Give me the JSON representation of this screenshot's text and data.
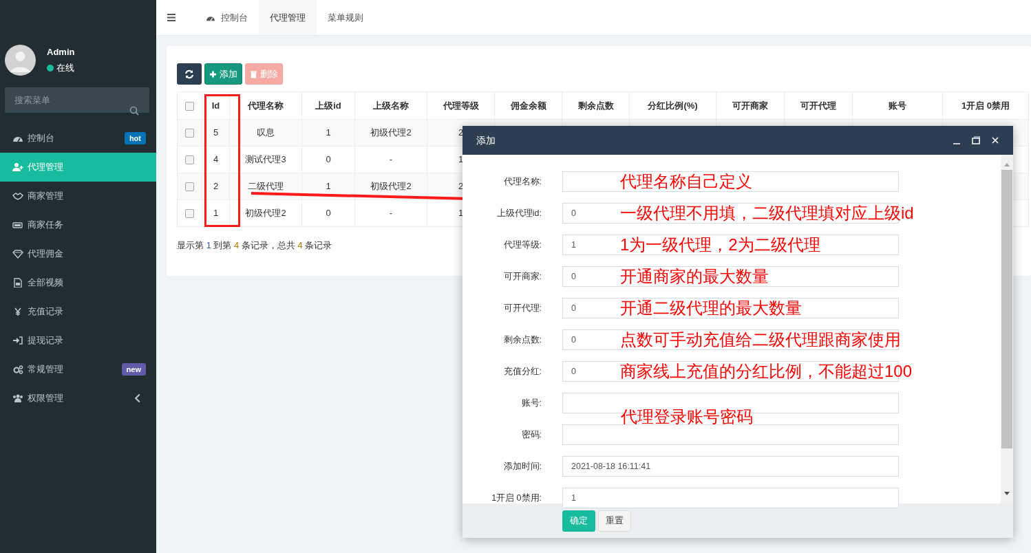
{
  "sidebar": {
    "user": {
      "name": "Admin",
      "status": "在线"
    },
    "search": {
      "placeholder": "搜索菜单"
    },
    "items": [
      {
        "label": "控制台",
        "selected": false,
        "has_submenu": false,
        "badge": {
          "text": "hot",
          "color": "#0073b7"
        }
      },
      {
        "label": "代理管理",
        "selected": true,
        "has_submenu": false
      },
      {
        "label": "商家管理",
        "selected": false,
        "has_submenu": false
      },
      {
        "label": "商家任务",
        "selected": false,
        "has_submenu": false
      },
      {
        "label": "代理佣金",
        "selected": false,
        "has_submenu": false
      },
      {
        "label": "全部视频",
        "selected": false,
        "has_submenu": false
      },
      {
        "label": "充值记录",
        "selected": false,
        "has_submenu": false
      },
      {
        "label": "提现记录",
        "selected": false,
        "has_submenu": false
      },
      {
        "label": "常规管理",
        "selected": false,
        "has_submenu": false,
        "badge": {
          "text": "new",
          "color": "#605ca8"
        }
      },
      {
        "label": "权限管理",
        "selected": false,
        "has_submenu": true
      }
    ]
  },
  "tabs": [
    {
      "label": "控制台",
      "selected": false
    },
    {
      "label": "代理管理",
      "selected": true
    },
    {
      "label": "菜单规则",
      "selected": false
    }
  ],
  "toolbar": [
    {
      "kind": "refresh",
      "disabled": false
    },
    {
      "kind": "add",
      "label": "添加",
      "disabled": false
    },
    {
      "kind": "delete",
      "label": "删除",
      "disabled": true
    }
  ],
  "table": {
    "all_checked": false,
    "columns": [
      "Id",
      "代理名称",
      "上级id",
      "上级名称",
      "代理等级",
      "佣金余额",
      "剩余点数",
      "分红比例(%)",
      "可开商家",
      "可开代理",
      "账号",
      "1开启 0禁用"
    ],
    "rows": [
      {
        "checked": false,
        "cells": [
          "5",
          "叹息",
          "1",
          "初级代理2",
          "2"
        ]
      },
      {
        "checked": false,
        "cells": [
          "4",
          "测试代理3",
          "0",
          "-",
          "1"
        ]
      },
      {
        "checked": false,
        "cells": [
          "2",
          "二级代理",
          "1",
          "初级代理2",
          "2"
        ]
      },
      {
        "checked": false,
        "cells": [
          "1",
          "初级代理2",
          "0",
          "-",
          "1"
        ]
      }
    ]
  },
  "pagination_info": [
    "显示第 ",
    "1",
    " 到第 ",
    "4",
    " 条记录，总共 ",
    "4",
    " 条记录"
  ],
  "modal": {
    "title": "添加",
    "fields": [
      {
        "label": "代理名称:",
        "annotation": "代理名称自己定义"
      },
      {
        "label": "上级代理id:",
        "value": "0",
        "annotation": "一级代理不用填，二级代理填对应上级id"
      },
      {
        "label": "代理等级:",
        "value": "1",
        "annotation": "1为一级代理，2为二级代理"
      },
      {
        "label": "可开商家:",
        "value": "0",
        "annotation": "开通商家的最大数量"
      },
      {
        "label": "可开代理:",
        "value": "0",
        "annotation": "开通二级代理的最大数量"
      },
      {
        "label": "剩余点数:",
        "value": "0",
        "annotation": "点数可手动充值给二级代理跟商家使用"
      },
      {
        "label": "充值分红:",
        "value": "0",
        "annotation": "商家线上充值的分红比例，不能超过100"
      },
      {
        "label": "账号:",
        "annotation": "代理登录账号密码"
      },
      {
        "label": "密码:"
      },
      {
        "label": "添加时间:",
        "value": "2021-08-18 16:11:41"
      },
      {
        "label": "1开启 0禁用:",
        "value": "1"
      }
    ],
    "buttons": [
      {
        "label": "确定",
        "kind": "primary"
      },
      {
        "label": "重置",
        "kind": "default"
      }
    ]
  }
}
